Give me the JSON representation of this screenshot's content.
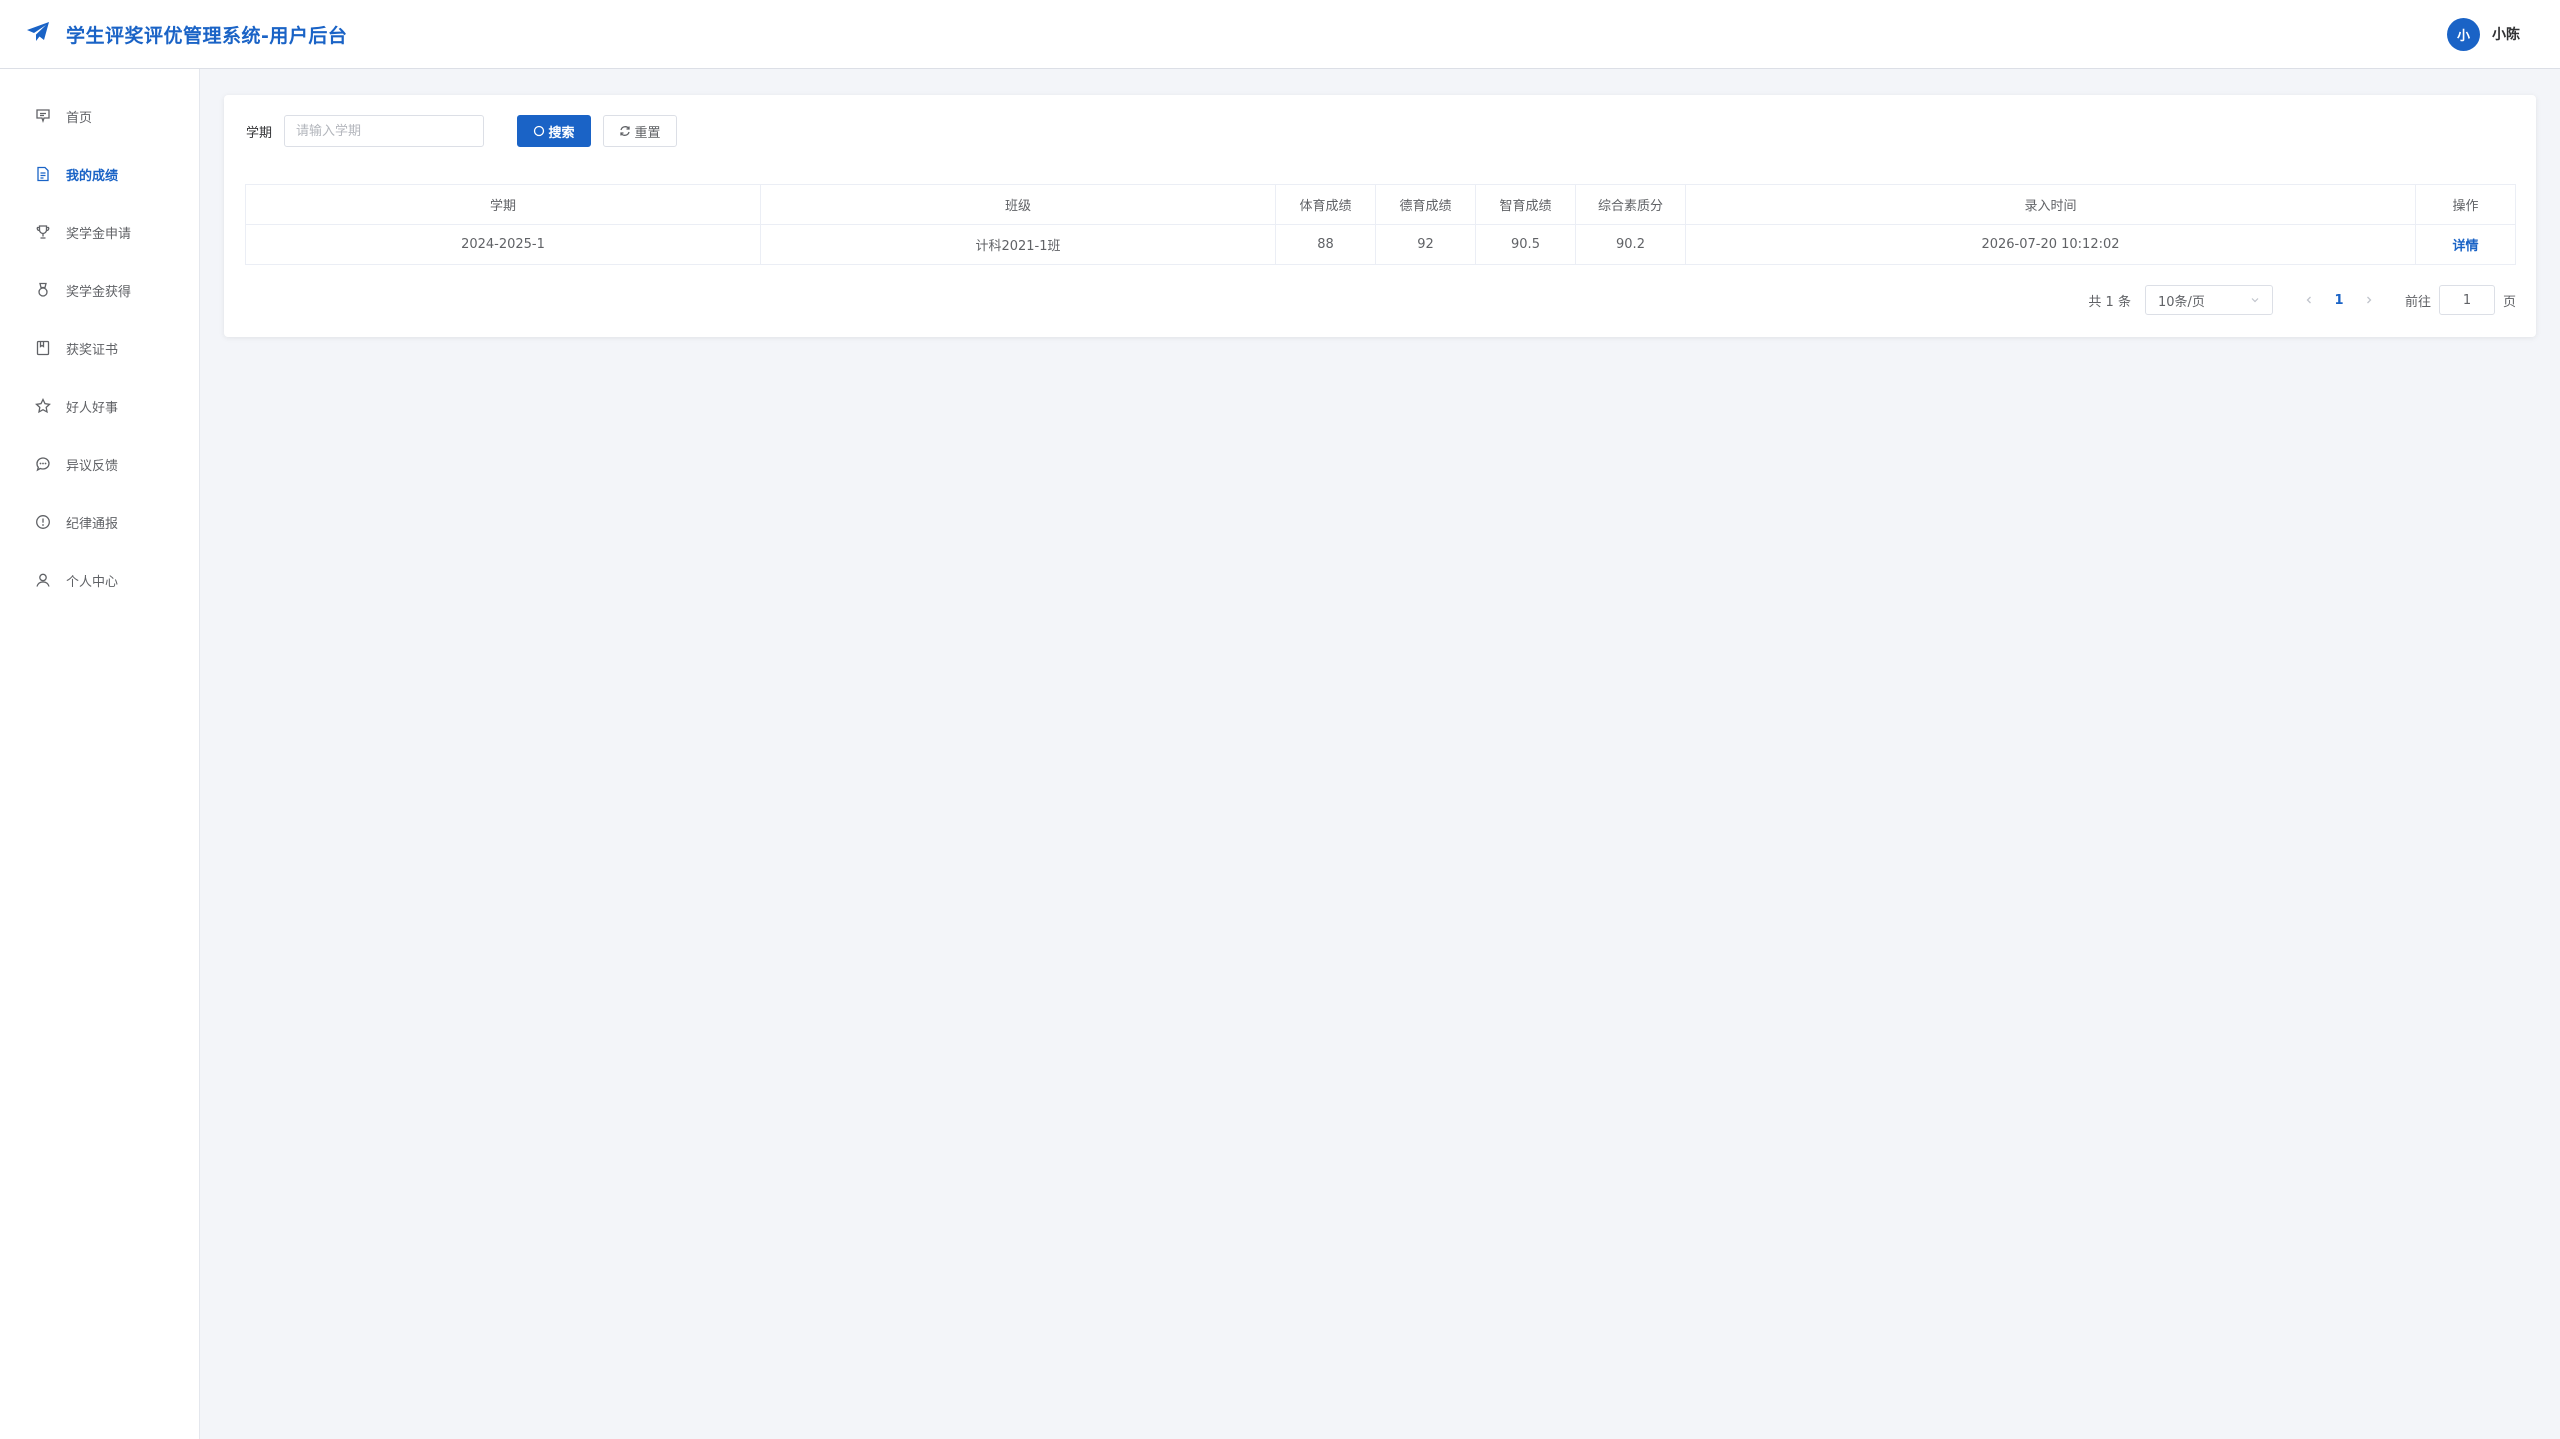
{
  "header": {
    "title": "学生评奖评优管理系统-用户后台",
    "logo_icon": "paper-plane-icon",
    "user": {
      "avatar_text": "小",
      "name": "小陈"
    }
  },
  "sidebar": {
    "items": [
      {
        "label": "首页",
        "icon": "home-icon",
        "active": false
      },
      {
        "label": "我的成绩",
        "icon": "document-icon",
        "active": true
      },
      {
        "label": "奖学金申请",
        "icon": "trophy-icon",
        "active": false
      },
      {
        "label": "奖学金获得",
        "icon": "medal-icon",
        "active": false
      },
      {
        "label": "获奖证书",
        "icon": "certificate-icon",
        "active": false
      },
      {
        "label": "好人好事",
        "icon": "star-icon",
        "active": false
      },
      {
        "label": "异议反馈",
        "icon": "chat-icon",
        "active": false
      },
      {
        "label": "纪律通报",
        "icon": "warning-icon",
        "active": false
      },
      {
        "label": "个人中心",
        "icon": "user-icon",
        "active": false
      }
    ]
  },
  "search": {
    "label": "学期",
    "placeholder": "请输入学期",
    "value": "",
    "search_label": "搜索",
    "reset_label": "重置"
  },
  "table": {
    "columns": [
      "学期",
      "班级",
      "体育成绩",
      "德育成绩",
      "智育成绩",
      "综合素质分",
      "录入时间",
      "操作"
    ],
    "rows": [
      [
        "2024-2025-1",
        "计科2021-1班",
        "88",
        "92",
        "90.5",
        "90.2",
        "2026-07-20 10:12:02",
        "详情"
      ]
    ]
  },
  "pagination": {
    "total_text": "共 1 条",
    "page_size": "10条/页",
    "current_page": "1",
    "goto_label": "前往",
    "goto_value": "1",
    "page_suffix": "页"
  },
  "colors": {
    "primary": "#1a63c6",
    "background": "#f3f5f9"
  }
}
